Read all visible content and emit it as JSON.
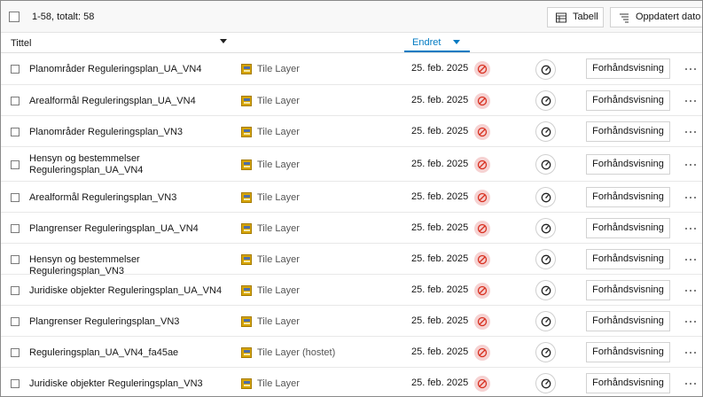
{
  "toolbar": {
    "count_text": "1-58, totalt: 58",
    "table_label": "Tabell",
    "sort_label": "Oppdatert dato",
    "table_icon": "table-icon",
    "sort_icon": "sort-icon"
  },
  "header": {
    "title": "Tittel",
    "changed": "Endret"
  },
  "colors": {
    "accent": "#007ac2",
    "status_bg": "#f6d2d2",
    "status_fg": "#d83020"
  },
  "rows": [
    {
      "title": "Planområder Reguleringsplan_UA_VN4",
      "type": "Tile Layer",
      "date": "25. feb. 2025",
      "status_icon": "blocked-icon",
      "action_label": "Forhåndsvisning"
    },
    {
      "title": "Arealformål Reguleringsplan_UA_VN4",
      "type": "Tile Layer",
      "date": "25. feb. 2025",
      "status_icon": "blocked-icon",
      "action_label": "Forhåndsvisning"
    },
    {
      "title": "Planområder Reguleringsplan_VN3",
      "type": "Tile Layer",
      "date": "25. feb. 2025",
      "status_icon": "blocked-icon",
      "action_label": "Forhåndsvisning"
    },
    {
      "title": "Hensyn og bestemmelser Reguleringsplan_UA_VN4",
      "type": "Tile Layer",
      "date": "25. feb. 2025",
      "status_icon": "blocked-icon",
      "action_label": "Forhåndsvisning"
    },
    {
      "title": "Arealformål Reguleringsplan_VN3",
      "type": "Tile Layer",
      "date": "25. feb. 2025",
      "status_icon": "blocked-icon",
      "action_label": "Forhåndsvisning"
    },
    {
      "title": "Plangrenser Reguleringsplan_UA_VN4",
      "type": "Tile Layer",
      "date": "25. feb. 2025",
      "status_icon": "blocked-icon",
      "action_label": "Forhåndsvisning"
    },
    {
      "title": "Hensyn og bestemmelser Reguleringsplan_VN3",
      "type": "Tile Layer",
      "date": "25. feb. 2025",
      "status_icon": "blocked-icon",
      "action_label": "Forhåndsvisning"
    },
    {
      "title": "Juridiske objekter Reguleringsplan_UA_VN4",
      "type": "Tile Layer",
      "date": "25. feb. 2025",
      "status_icon": "blocked-icon",
      "action_label": "Forhåndsvisning"
    },
    {
      "title": "Plangrenser Reguleringsplan_VN3",
      "type": "Tile Layer",
      "date": "25. feb. 2025",
      "status_icon": "blocked-icon",
      "action_label": "Forhåndsvisning"
    },
    {
      "title": "Reguleringsplan_UA_VN4_fa45ae",
      "type": "Tile Layer (hostet)",
      "date": "25. feb. 2025",
      "status_icon": "blocked-icon",
      "action_label": "Forhåndsvisning"
    },
    {
      "title": "Juridiske objekter Reguleringsplan_VN3",
      "type": "Tile Layer",
      "date": "25. feb. 2025",
      "status_icon": "blocked-icon",
      "action_label": "Forhåndsvisning"
    }
  ]
}
